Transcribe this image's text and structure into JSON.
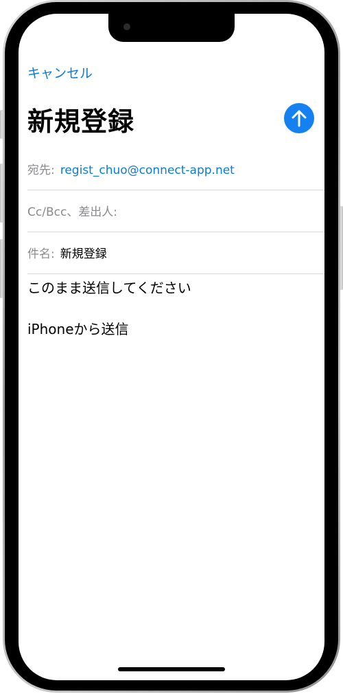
{
  "header": {
    "cancel_label": "キャンセル",
    "title": "新規登録"
  },
  "send_button": {
    "icon": "arrow-up-icon",
    "color": "#1581f1"
  },
  "fields": {
    "to_label": "宛先:",
    "to_value": "regist_chuo@connect-app.net",
    "cc_label": "Cc/Bcc、差出人:",
    "subject_label": "件名:",
    "subject_value": "新規登録"
  },
  "body": {
    "line1": "このまま送信してください",
    "line2": "iPhoneから送信"
  },
  "colors": {
    "accent": "#0a7bd9",
    "label": "#8a8a8e",
    "divider": "#d9d9d9"
  }
}
